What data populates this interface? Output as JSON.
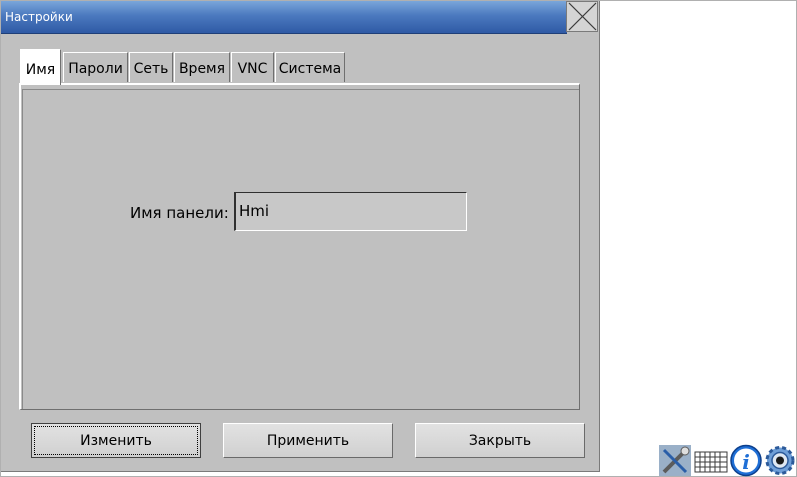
{
  "window": {
    "title": "Настройки"
  },
  "tabs": [
    {
      "label": "Имя",
      "active": true
    },
    {
      "label": "Пароли",
      "active": false
    },
    {
      "label": "Сеть",
      "active": false
    },
    {
      "label": "Время",
      "active": false
    },
    {
      "label": "VNC",
      "active": false
    },
    {
      "label": "Система",
      "active": false
    }
  ],
  "name_tab": {
    "panel_name_label": "Имя панели:",
    "panel_name_value": "Hmi"
  },
  "buttons": {
    "change_label": "Изменить",
    "apply_label": "Применить",
    "close_label": "Закрыть"
  },
  "tray": {
    "icons": [
      "tools-icon",
      "keyboard-icon",
      "info-icon",
      "settings-gear-icon"
    ]
  },
  "colors": {
    "title_bar": "#4b79bf",
    "window_bg": "#c0c0c0",
    "info_icon": "#1f6fd6"
  }
}
